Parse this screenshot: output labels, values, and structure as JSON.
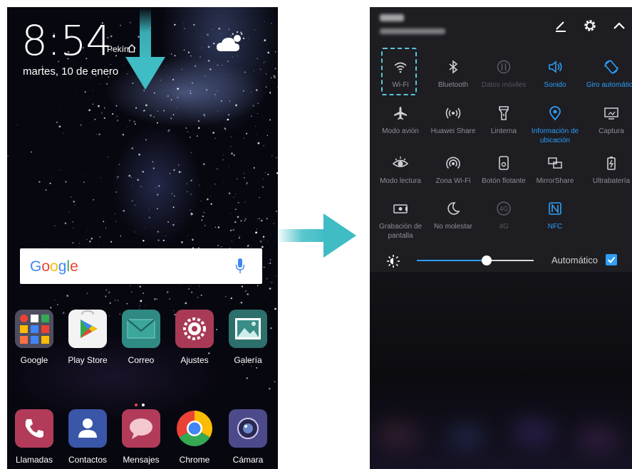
{
  "lock_screen": {
    "time": "8:54",
    "city": "Pekín",
    "date": "martes, 10 de enero",
    "search_logo": "Google",
    "apps_row1": [
      {
        "label": "Google",
        "icon": "google-folder-icon"
      },
      {
        "label": "Play Store",
        "icon": "play-store-icon"
      },
      {
        "label": "Correo",
        "icon": "mail-icon"
      },
      {
        "label": "Ajustes",
        "icon": "settings-icon"
      },
      {
        "label": "Galería",
        "icon": "gallery-icon"
      }
    ],
    "apps_dock": [
      {
        "label": "Llamadas",
        "icon": "phone-icon"
      },
      {
        "label": "Contactos",
        "icon": "contacts-icon"
      },
      {
        "label": "Mensajes",
        "icon": "messages-icon"
      },
      {
        "label": "Chrome",
        "icon": "chrome-icon"
      },
      {
        "label": "Cámara",
        "icon": "camera-icon"
      }
    ]
  },
  "quick_settings": {
    "tiles": [
      {
        "label": "Wi-Fi",
        "state": "off",
        "icon": "wifi-icon"
      },
      {
        "label": "Bluetooth",
        "state": "off",
        "icon": "bluetooth-icon"
      },
      {
        "label": "Datos móviles",
        "state": "dim",
        "icon": "mobile-data-icon"
      },
      {
        "label": "Sonido",
        "state": "on",
        "icon": "sound-icon"
      },
      {
        "label": "Giro automático",
        "state": "on",
        "icon": "auto-rotate-icon"
      },
      {
        "label": "Modo avión",
        "state": "off",
        "icon": "airplane-icon"
      },
      {
        "label": "Huawei Share",
        "state": "off",
        "icon": "huawei-share-icon"
      },
      {
        "label": "Linterna",
        "state": "off",
        "icon": "flashlight-icon"
      },
      {
        "label": "Información de ubicación",
        "state": "on",
        "icon": "location-icon"
      },
      {
        "label": "Captura",
        "state": "off",
        "icon": "screenshot-icon"
      },
      {
        "label": "Modo lectura",
        "state": "off",
        "icon": "eye-icon"
      },
      {
        "label": "Zona Wi-Fi",
        "state": "off",
        "icon": "hotspot-icon"
      },
      {
        "label": "Botón flotante",
        "state": "off",
        "icon": "floating-button-icon"
      },
      {
        "label": "MirrorShare",
        "state": "off",
        "icon": "mirror-share-icon"
      },
      {
        "label": "Ultrabatería",
        "state": "off",
        "icon": "battery-saver-icon"
      },
      {
        "label": "Grabación de pantalla",
        "state": "off",
        "icon": "screen-record-icon"
      },
      {
        "label": "No molestar",
        "state": "off",
        "icon": "moon-icon"
      },
      {
        "label": "4G",
        "state": "dim",
        "icon": "4g-icon"
      },
      {
        "label": "NFC",
        "state": "on",
        "icon": "nfc-icon"
      }
    ],
    "brightness": {
      "label": "Automático",
      "level": 0.6,
      "auto": true
    }
  },
  "colors": {
    "accent": "#2f9ef7",
    "highlight": "#5bc6d6",
    "arrow": "#3fbcc4"
  }
}
